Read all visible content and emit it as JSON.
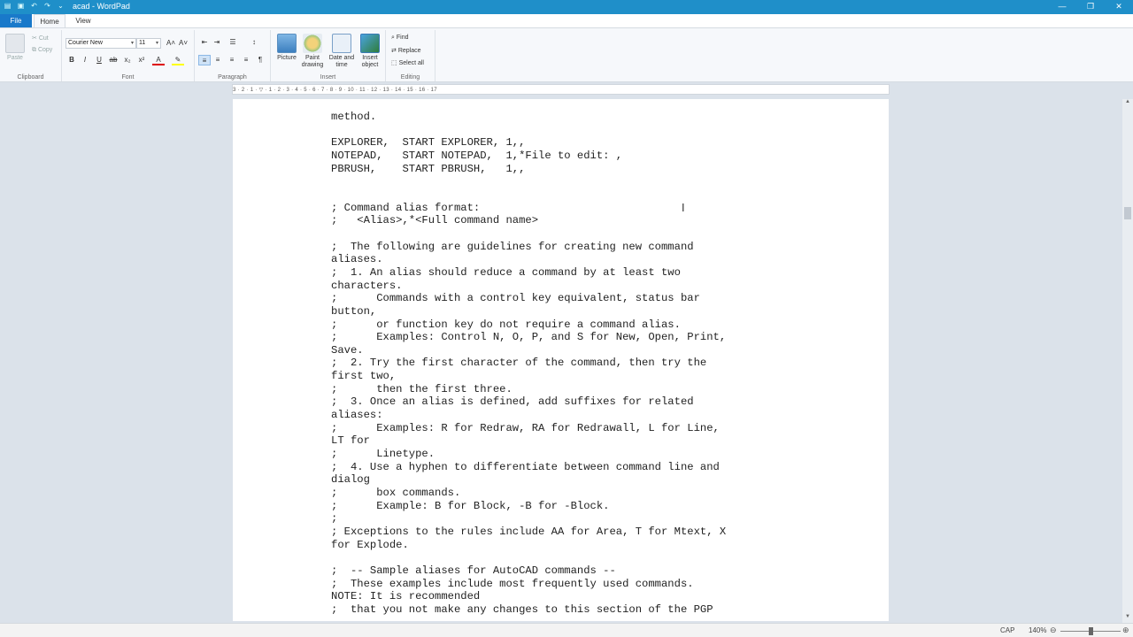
{
  "window": {
    "title": "acad - WordPad",
    "controls": [
      "—",
      "❐",
      "✕"
    ]
  },
  "tabs": [
    "File",
    "Home",
    "View"
  ],
  "ribbon": {
    "clipboard": {
      "paste": "Paste",
      "cut": "Cut",
      "copy": "Copy",
      "label": "Clipboard"
    },
    "font": {
      "family": "Courier New",
      "size": "11",
      "label": "Font"
    },
    "paragraph": {
      "label": "Paragraph"
    },
    "insert": {
      "picture": "Picture",
      "paint": "Paint drawing",
      "datetime": "Date and time",
      "object": "Insert object",
      "label": "Insert"
    },
    "editing": {
      "find": "Find",
      "replace": "Replace",
      "select_all": "Select all",
      "label": "Editing"
    }
  },
  "ruler": "3 · 2 · 1 · ▽ · 1 · 2 · 3 · 4 · 5 · 6 · 7 · 8 · 9 · 10 · 11 · 12 · 13 · 14 · 15 · 16 · 17",
  "document": {
    "text": "method.\n\nEXPLORER,  START EXPLORER, 1,,\nNOTEPAD,   START NOTEPAD,  1,*File to edit: ,\nPBRUSH,    START PBRUSH,   1,,\n\n\n; Command alias format:\n;   <Alias>,*<Full command name>\n\n;  The following are guidelines for creating new command\naliases.\n;  1. An alias should reduce a command by at least two\ncharacters.\n;      Commands with a control key equivalent, status bar\nbutton,\n;      or function key do not require a command alias.\n;      Examples: Control N, O, P, and S for New, Open, Print,\nSave.\n;  2. Try the first character of the command, then try the\nfirst two,\n;      then the first three.\n;  3. Once an alias is defined, add suffixes for related\naliases:\n;      Examples: R for Redraw, RA for Redrawall, L for Line,\nLT for\n;      Linetype.\n;  4. Use a hyphen to differentiate between command line and\ndialog\n;      box commands.\n;      Example: B for Block, -B for -Block.\n;\n; Exceptions to the rules include AA for Area, T for Mtext, X\nfor Explode.\n\n;  -- Sample aliases for AutoCAD commands --\n;  These examples include most frequently used commands.\nNOTE: It is recommended\n;  that you not make any changes to this section of the PGP"
  },
  "status": {
    "caps": "CAP",
    "zoom": "140%"
  }
}
